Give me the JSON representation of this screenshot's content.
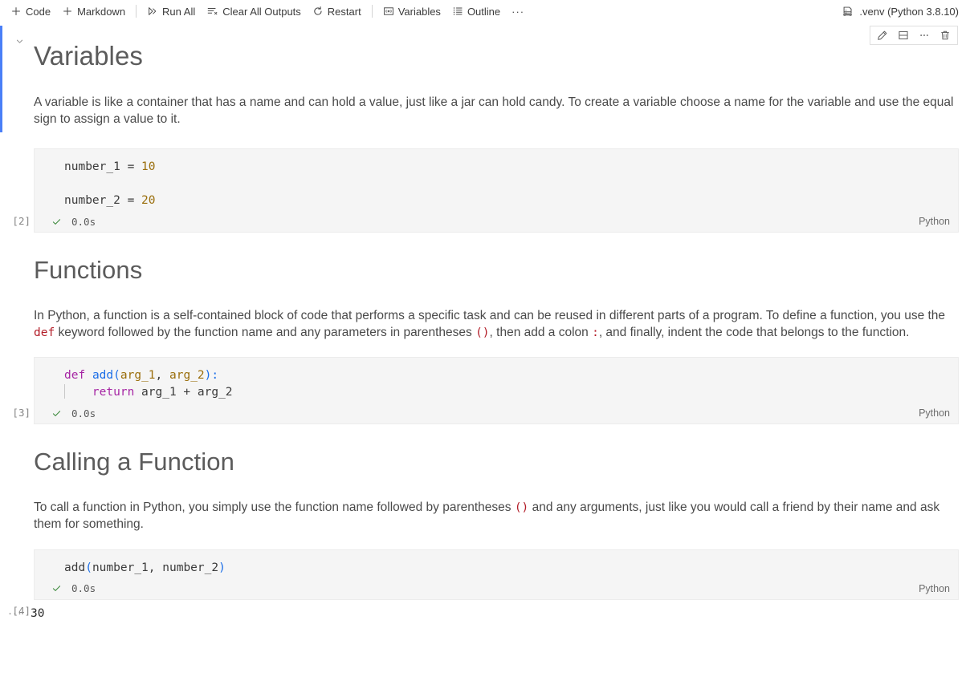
{
  "toolbar": {
    "items": [
      {
        "label": "Code",
        "icon": "plus-icon",
        "name": "add-code-cell-button"
      },
      {
        "label": "Markdown",
        "icon": "plus-icon",
        "name": "add-markdown-cell-button"
      },
      {
        "label": "Run All",
        "icon": "run-all-icon",
        "name": "run-all-button"
      },
      {
        "label": "Clear All Outputs",
        "icon": "clear-outputs-icon",
        "name": "clear-all-outputs-button"
      },
      {
        "label": "Restart",
        "icon": "restart-icon",
        "name": "restart-button"
      },
      {
        "label": "Variables",
        "icon": "variables-icon",
        "name": "variables-button"
      },
      {
        "label": "Outline",
        "icon": "outline-icon",
        "name": "outline-button"
      }
    ],
    "more_label": "···",
    "kernel": {
      "icon": "kernel-server-icon",
      "label": ".venv (Python 3.8.10)"
    }
  },
  "cell_toolbar": {
    "buttons": [
      {
        "icon": "pencil-icon",
        "name": "edit-cell-button"
      },
      {
        "icon": "split-cell-icon",
        "name": "split-cell-button"
      },
      {
        "icon": "more-icon",
        "name": "more-actions-button"
      },
      {
        "icon": "trash-icon",
        "name": "delete-cell-button"
      }
    ]
  },
  "colors": {
    "accent": "#4a7ff7",
    "code_bg": "#f5f5f5",
    "inline_code": "#b31d28",
    "success": "#3d8a3d",
    "keyword": "#a626a4",
    "function": "#1b6ee8",
    "number": "#9a6e0c"
  },
  "cells": {
    "variables_heading": "Variables",
    "variables_paragraph": "A variable is like a container that has a name and can hold a value, just like a jar can hold candy. To create a variable choose a name for the variable and use the equal sign to assign a value to it.",
    "code_1": {
      "exec_count": "[2]",
      "lines": [
        "number_1 = 10",
        "",
        "number_2 = 20"
      ],
      "tokens": {
        "var_1": "number_1",
        "val_1": "10",
        "var_2": "number_2",
        "val_2": "20",
        "equals": " = "
      },
      "status": "0.0s",
      "language": "Python"
    },
    "functions_heading": "Functions",
    "functions_paragraph": {
      "part_1": "In Python, a function is a self-contained block of code that performs a specific task and can be reused in different parts of a program. To define a function, you use the ",
      "code_1": "def",
      "part_2": " keyword followed by the function name and any parameters in parentheses ",
      "code_2": "()",
      "part_3": ", then add a colon ",
      "code_3": ":",
      "part_4": ", and finally, indent the code that belongs to the function."
    },
    "code_2": {
      "exec_count": "[3]",
      "lines": [
        "def add(arg_1, arg_2):",
        "    return arg_1 + arg_2"
      ],
      "tokens": {
        "kw_def": "def",
        "fn_name": "add",
        "paren_open": "(",
        "param_1": "arg_1",
        "comma": ", ",
        "param_2": "arg_2",
        "paren_close": ")",
        "colon": ":",
        "kw_return": "return",
        "expr": " arg_1 + arg_2"
      },
      "status": "0.0s",
      "language": "Python"
    },
    "calling_heading": "Calling a Function",
    "calling_paragraph": {
      "part_1": "To call a function in Python, you simply use the function name followed by parentheses ",
      "code_1": "()",
      "part_2": " and any arguments, just like you would call a friend by their name and ask them for something."
    },
    "code_3": {
      "exec_count": "[4]",
      "lines": [
        "add(number_1, number_2)"
      ],
      "tokens": {
        "fn_name": "add",
        "paren_open": "(",
        "arg_1": "number_1",
        "comma": ", ",
        "arg_2": "number_2",
        "paren_close": ")"
      },
      "status": "0.0s",
      "language": "Python",
      "output": "30",
      "output_toggle": "···"
    }
  }
}
